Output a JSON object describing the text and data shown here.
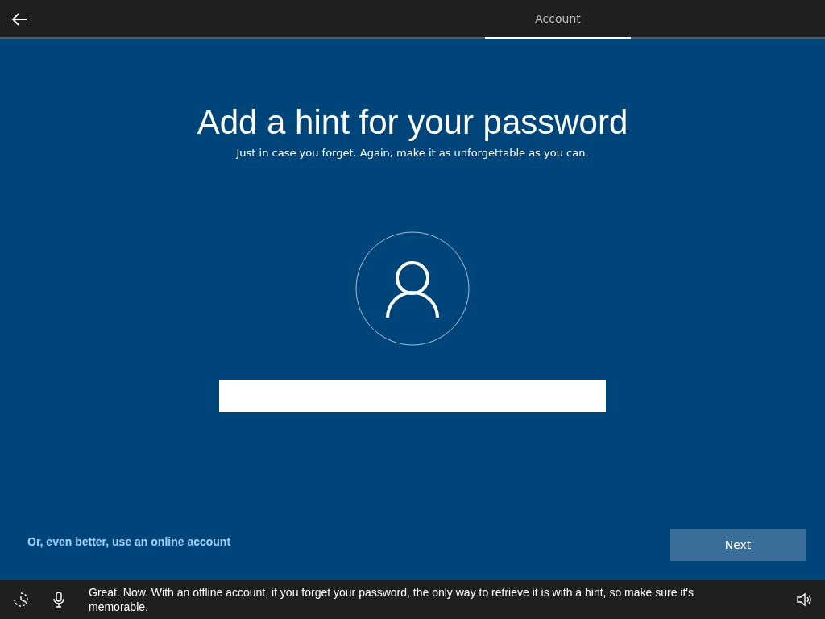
{
  "tabs": [
    {
      "label": "Account",
      "selected": true
    }
  ],
  "title": "Add a hint for your password",
  "subtitle": "Just in case you forget. Again, make it as unforgettable as you can.",
  "online_account_link": "Or, even better, use an online account",
  "buttons": [
    {
      "label": "Next"
    }
  ],
  "narration": "Great. Now. With an offline account, if you forget your password, the only way to retrieve it is with a hint, so make sure it's memorable."
}
